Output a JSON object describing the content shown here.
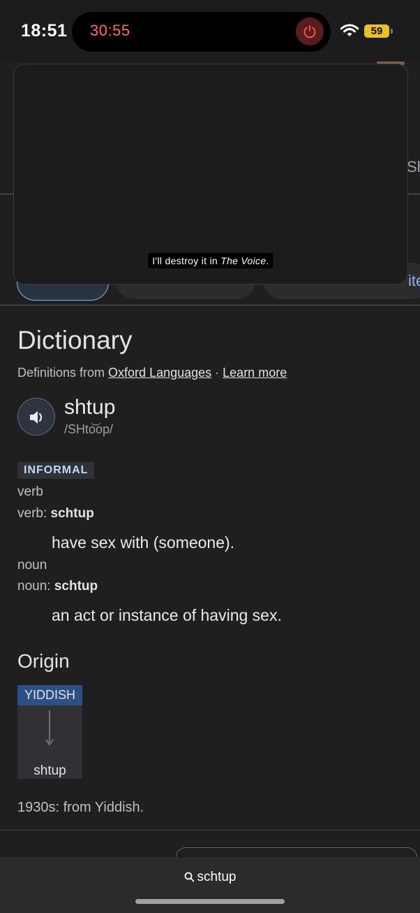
{
  "status_bar": {
    "time": "18:51",
    "recording_timer": "30:55",
    "battery": "59"
  },
  "pip": {
    "caption_prefix": "I'll destroy it in ",
    "caption_title": "The Voice",
    "caption_suffix": "."
  },
  "background": {
    "side_text": "Sh",
    "chip_text": "ite"
  },
  "dictionary": {
    "title": "Dictionary",
    "source_prefix": "Definitions from ",
    "source_link": "Oxford Languages",
    "separator": " · ",
    "learn_more": "Learn more",
    "headword": "shtup",
    "phonetic": "/SHto͝op/",
    "register": "INFORMAL",
    "senses": [
      {
        "pos": "verb",
        "form_label": "verb: ",
        "form": "schtup",
        "definition": "have sex with (someone)."
      },
      {
        "pos": "noun",
        "form_label": "noun: ",
        "form": "schtup",
        "definition": "an act or instance of having sex."
      }
    ]
  },
  "origin": {
    "title": "Origin",
    "language": "YIDDISH",
    "word": "shtup",
    "note": "1930s: from Yiddish."
  },
  "url_bar": {
    "query": "schtup"
  },
  "colors": {
    "accent_blue": "#8ab4f8",
    "recording_red": "#ff6b5e",
    "battery_yellow": "#e8c22e",
    "origin_header": "#2c4f86"
  },
  "icons": {
    "stop": "stop-recording-icon",
    "wifi": "wifi-icon",
    "speaker": "speaker-icon",
    "search": "search-icon"
  }
}
